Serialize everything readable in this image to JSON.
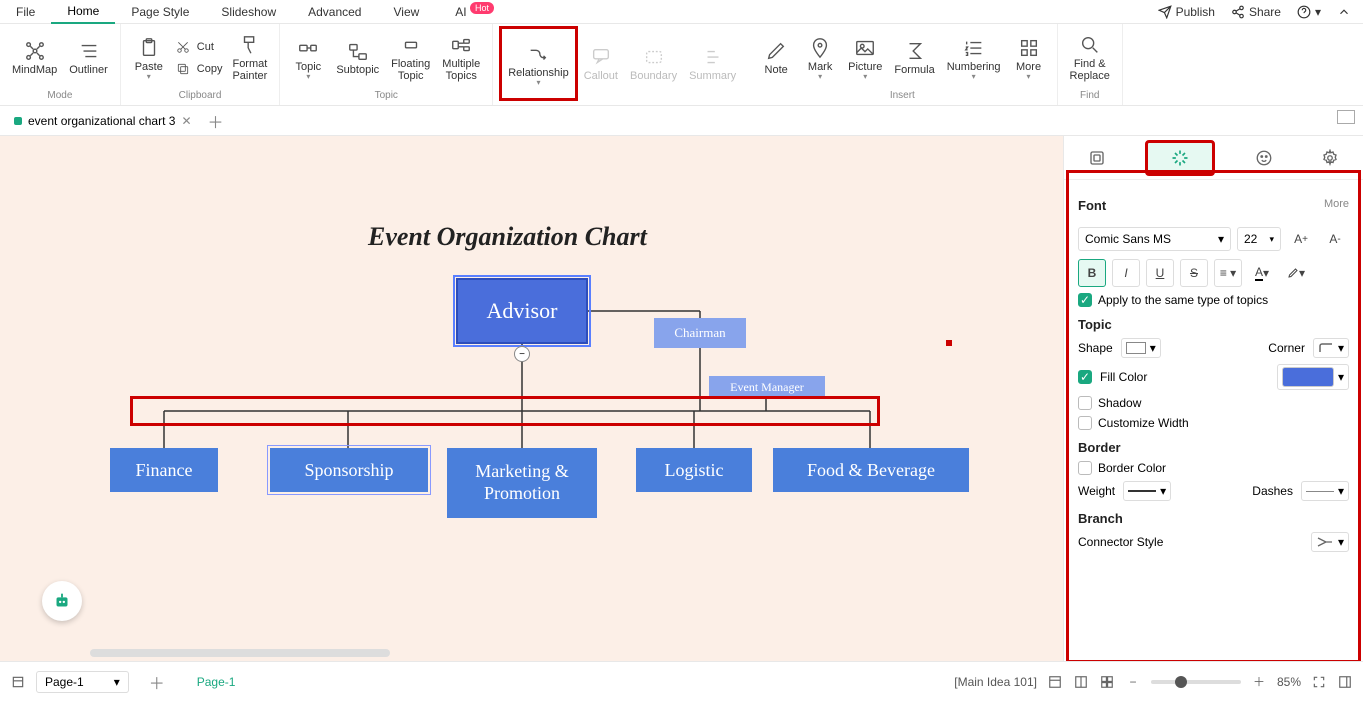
{
  "menu": {
    "file": "File",
    "home": "Home",
    "pagestyle": "Page Style",
    "slideshow": "Slideshow",
    "advanced": "Advanced",
    "view": "View",
    "ai": "AI",
    "hot": "Hot",
    "publish": "Publish",
    "share": "Share"
  },
  "ribbon": {
    "mindmap": "MindMap",
    "outliner": "Outliner",
    "mode": "Mode",
    "paste": "Paste",
    "cut": "Cut",
    "copy": "Copy",
    "formatpainter": "Format\nPainter",
    "clipboard": "Clipboard",
    "topic": "Topic",
    "subtopic": "Subtopic",
    "floatingtopic": "Floating\nTopic",
    "multipletopics": "Multiple\nTopics",
    "topicgrp": "Topic",
    "relationship": "Relationship",
    "callout": "Callout",
    "boundary": "Boundary",
    "summary": "Summary",
    "note": "Note",
    "mark": "Mark",
    "picture": "Picture",
    "formula": "Formula",
    "numbering": "Numbering",
    "more": "More",
    "insert": "Insert",
    "findreplace": "Find &\nReplace",
    "find": "Find"
  },
  "tab": {
    "name": "event organizational chart 3"
  },
  "chart": {
    "title": "Event Organization Chart",
    "advisor": "Advisor",
    "chairman": "Chairman",
    "eventmgr": "Event Manager",
    "finance": "Finance",
    "sponsorship": "Sponsorship",
    "marketing": "Marketing & Promotion",
    "logistic": "Logistic",
    "food": "Food & Beverage"
  },
  "panel": {
    "font": "Font",
    "more": "More",
    "fontname": "Comic Sans MS",
    "fontsize": "22",
    "apply": "Apply to the same type of topics",
    "topic": "Topic",
    "shape": "Shape",
    "corner": "Corner",
    "fillcolor": "Fill Color",
    "shadow": "Shadow",
    "customwidth": "Customize Width",
    "border": "Border",
    "bordercolor": "Border Color",
    "weight": "Weight",
    "dashes": "Dashes",
    "branch": "Branch",
    "connector": "Connector Style"
  },
  "status": {
    "page": "Page-1",
    "pagetab": "Page-1",
    "mainidea": "[Main Idea 101]",
    "zoom": "85%"
  }
}
